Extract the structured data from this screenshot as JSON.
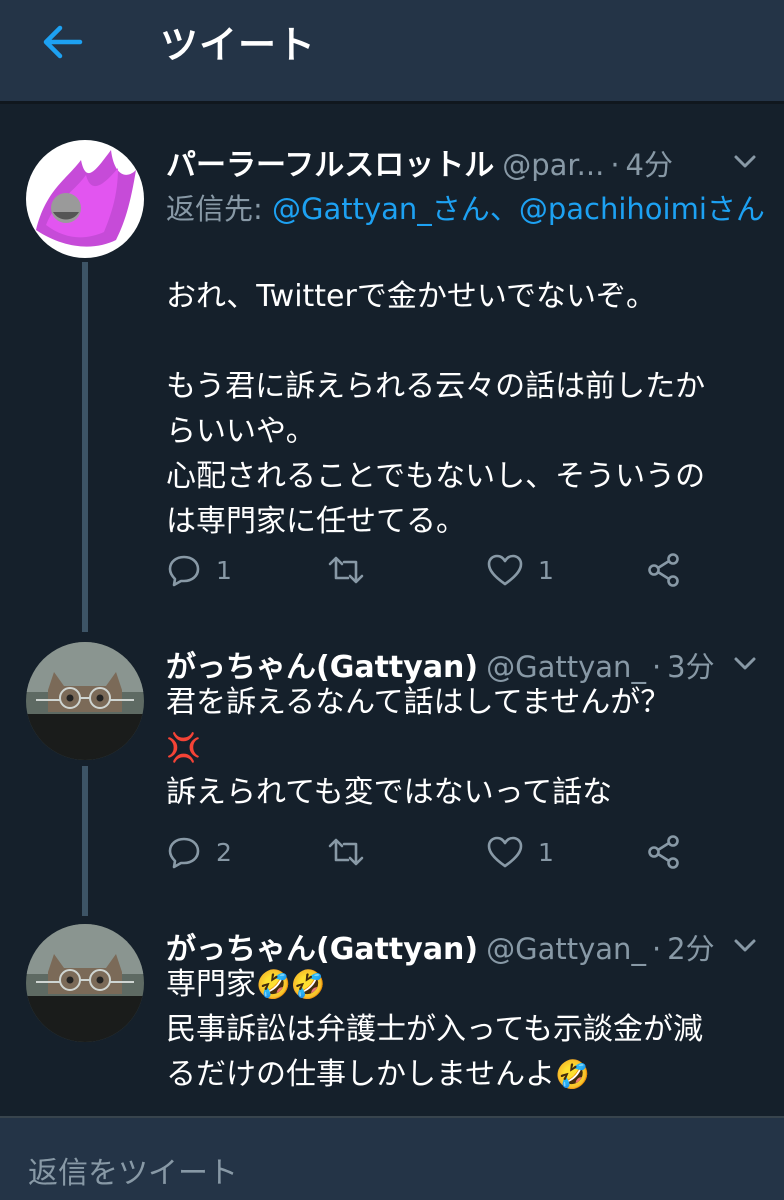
{
  "header": {
    "title": "ツイート",
    "back_icon": "arrow-left-icon",
    "accent": "#1da1f2"
  },
  "tweets": [
    {
      "name": "パーラーフルスロットル",
      "handle": "@par...",
      "time": "4分",
      "reply_to_label": "返信先:",
      "reply_to_user1": "@Gattyan_さん",
      "reply_sep": "、",
      "reply_to_user2": "@pachihoimiさん",
      "lines": [
        "おれ、Twitterで金かせいでないぞ。",
        "",
        "もう君に訴えられる云々の話は前したか",
        "らいいや。",
        "心配されることでもないし、そういうの",
        "は専門家に任せてる。"
      ],
      "replies": "1",
      "likes": "1"
    },
    {
      "name": "がっちゃん(Gattyan)",
      "handle": "@Gattyan_",
      "time": "3分",
      "line1": "君を訴えるなんて話はしてませんが？",
      "line2_emoji": "💢",
      "line3": "訴えられても変ではないって話な",
      "replies": "2",
      "likes": "1"
    },
    {
      "name": "がっちゃん(Gattyan)",
      "handle": "@Gattyan_",
      "time": "2分",
      "line1_text": "専門家",
      "line1_emoji": "🤣🤣",
      "line2": "民事訴訟は弁護士が入っても示談金が減",
      "line3_text": "るだけの仕事しかしませんよ",
      "line3_emoji": "🤣"
    }
  ],
  "footer": {
    "placeholder": "返信をツイート"
  },
  "colors": {
    "background": "#15202b",
    "header": "#243447",
    "secondary_text": "#8899a6",
    "link": "#1da1f2",
    "thread_line": "#3d5466"
  }
}
